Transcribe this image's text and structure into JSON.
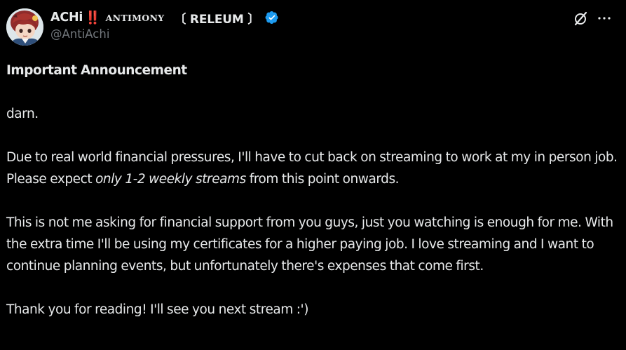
{
  "author": {
    "display_name": "ACHi",
    "emoji_badge": "‼️",
    "org_name": "ANTIMONY",
    "group_tag": "〔 RELEUM 〕",
    "handle": "@AntiAchi",
    "verified": true,
    "verified_color": "#1d9bf0",
    "avatar_icon": "anime-avatar"
  },
  "actions": {
    "grok_icon": "grok-slash-icon",
    "more_icon": "more-dots-icon",
    "more_glyph": "···"
  },
  "post": {
    "title": "Important Announcement",
    "line1": "darn.",
    "para2_before": "Due to real world financial pressures, I'll have to cut back on streaming to work at my in person job. Please expect ",
    "para2_emphasis": "only 1-2 weekly streams",
    "para2_after": " from this point onwards.",
    "para3": "This is not me asking for financial support from you guys, just you watching is enough for me. With the extra time I'll be using my certificates for a higher paying job. I love streaming and I want to continue planning events, but unfortunately there's expenses that come first.",
    "para4": "Thank you for reading! I'll see you next stream :')"
  },
  "colors": {
    "background": "#000000",
    "text": "#e7e9ea",
    "secondary_text": "#71767b",
    "emoji_red": "#e5202c",
    "verified_blue": "#1d9bf0"
  }
}
